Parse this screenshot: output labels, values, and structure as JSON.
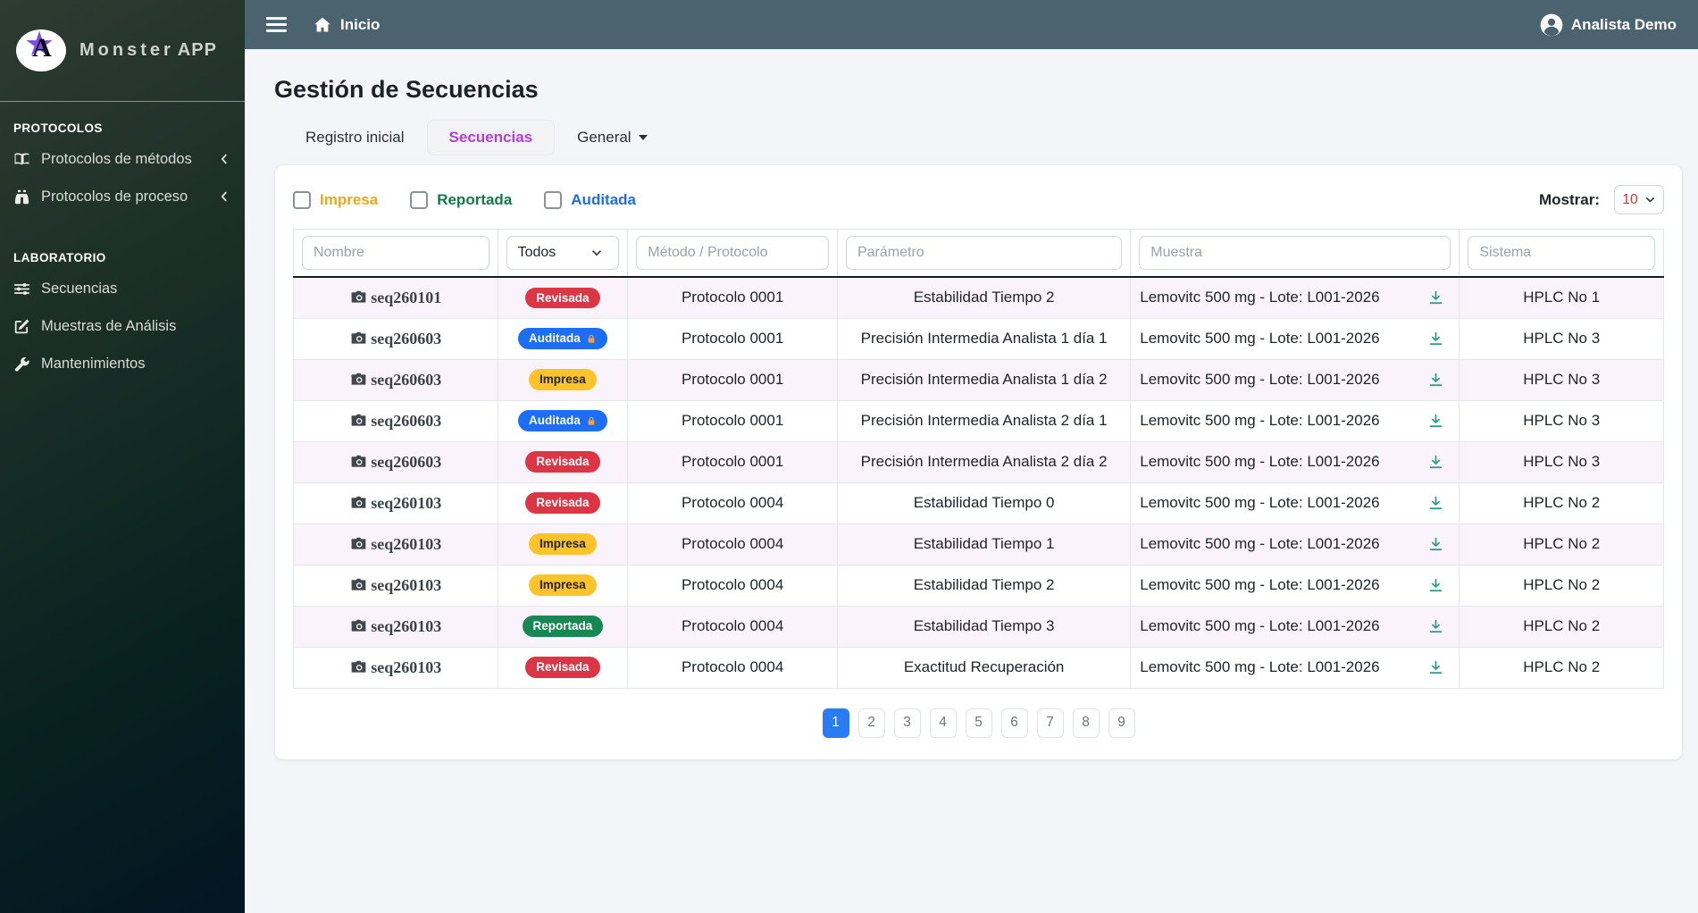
{
  "brand": {
    "name_main": "Monster",
    "name_suffix": "APP"
  },
  "navbar": {
    "breadcrumb": "Inicio",
    "user": "Analista Demo"
  },
  "sidebar": {
    "sections": [
      {
        "title": "PROTOCOLOS",
        "items": [
          {
            "label": "Protocolos de métodos",
            "icon": "book-icon",
            "chevron": true
          },
          {
            "label": "Protocolos de proceso",
            "icon": "binoculars-icon",
            "chevron": true
          }
        ]
      },
      {
        "title": "LABORATORIO",
        "items": [
          {
            "label": "Secuencias",
            "icon": "sliders-icon",
            "chevron": false
          },
          {
            "label": "Muestras de Análisis",
            "icon": "edit-icon",
            "chevron": false
          },
          {
            "label": "Mantenimientos",
            "icon": "wrench-icon",
            "chevron": false
          }
        ]
      }
    ]
  },
  "page": {
    "title": "Gestión de Secuencias",
    "tabs": [
      {
        "label": "Registro inicial",
        "active": false,
        "dropdown": false
      },
      {
        "label": "Secuencias",
        "active": true,
        "dropdown": false
      },
      {
        "label": "General",
        "active": false,
        "dropdown": true
      }
    ]
  },
  "filters": {
    "checkboxes": [
      {
        "label": "Impresa",
        "color": "#f0a818",
        "checked": false
      },
      {
        "label": "Reportada",
        "color": "#157a4b",
        "checked": false
      },
      {
        "label": "Auditada",
        "color": "#1b6ef3",
        "checked": false
      }
    ],
    "show_label": "Mostrar:",
    "show_value": "10"
  },
  "table": {
    "filter_placeholders": {
      "nombre": "Nombre",
      "estado": "Todos",
      "metodo": "Método / Protocolo",
      "parametro": "Parámetro",
      "muestra": "Muestra",
      "sistema": "Sistema"
    },
    "rows": [
      {
        "name": "seq260101",
        "status": {
          "label": "Revisada",
          "variant": "revisada",
          "lock": false
        },
        "protocolo": "Protocolo 0001",
        "parametro": "Estabilidad Tiempo 2",
        "muestra": "Lemovitc 500 mg - Lote: L001-2026",
        "sistema": "HPLC No 1"
      },
      {
        "name": "seq260603",
        "status": {
          "label": "Auditada",
          "variant": "auditada",
          "lock": true
        },
        "protocolo": "Protocolo 0001",
        "parametro": "Precisión Intermedia Analista 1 día 1",
        "muestra": "Lemovitc 500 mg - Lote: L001-2026",
        "sistema": "HPLC No 3"
      },
      {
        "name": "seq260603",
        "status": {
          "label": "Impresa",
          "variant": "impresa",
          "lock": false
        },
        "protocolo": "Protocolo 0001",
        "parametro": "Precisión Intermedia Analista 1 día 2",
        "muestra": "Lemovitc 500 mg - Lote: L001-2026",
        "sistema": "HPLC No 3"
      },
      {
        "name": "seq260603",
        "status": {
          "label": "Auditada",
          "variant": "auditada",
          "lock": true
        },
        "protocolo": "Protocolo 0001",
        "parametro": "Precisión Intermedia Analista 2 día 1",
        "muestra": "Lemovitc 500 mg - Lote: L001-2026",
        "sistema": "HPLC No 3"
      },
      {
        "name": "seq260603",
        "status": {
          "label": "Revisada",
          "variant": "revisada",
          "lock": false
        },
        "protocolo": "Protocolo 0001",
        "parametro": "Precisión Intermedia Analista 2 día 2",
        "muestra": "Lemovitc 500 mg - Lote: L001-2026",
        "sistema": "HPLC No 3"
      },
      {
        "name": "seq260103",
        "status": {
          "label": "Revisada",
          "variant": "revisada",
          "lock": false
        },
        "protocolo": "Protocolo 0004",
        "parametro": "Estabilidad Tiempo 0",
        "muestra": "Lemovitc 500 mg - Lote: L001-2026",
        "sistema": "HPLC No 2"
      },
      {
        "name": "seq260103",
        "status": {
          "label": "Impresa",
          "variant": "impresa",
          "lock": false
        },
        "protocolo": "Protocolo 0004",
        "parametro": "Estabilidad Tiempo 1",
        "muestra": "Lemovitc 500 mg - Lote: L001-2026",
        "sistema": "HPLC No 2"
      },
      {
        "name": "seq260103",
        "status": {
          "label": "Impresa",
          "variant": "impresa",
          "lock": false
        },
        "protocolo": "Protocolo 0004",
        "parametro": "Estabilidad Tiempo 2",
        "muestra": "Lemovitc 500 mg - Lote: L001-2026",
        "sistema": "HPLC No 2"
      },
      {
        "name": "seq260103",
        "status": {
          "label": "Reportada",
          "variant": "reportada",
          "lock": false
        },
        "protocolo": "Protocolo 0004",
        "parametro": "Estabilidad Tiempo 3",
        "muestra": "Lemovitc 500 mg - Lote: L001-2026",
        "sistema": "HPLC No 2"
      },
      {
        "name": "seq260103",
        "status": {
          "label": "Revisada",
          "variant": "revisada",
          "lock": false
        },
        "protocolo": "Protocolo 0004",
        "parametro": "Exactitud Recuperación",
        "muestra": "Lemovitc 500 mg - Lote: L001-2026",
        "sistema": "HPLC No 2"
      }
    ]
  },
  "pagination": {
    "pages": [
      "1",
      "2",
      "3",
      "4",
      "5",
      "6",
      "7",
      "8",
      "9"
    ],
    "active": "1"
  },
  "colors": {
    "badge": {
      "revisada": {
        "bg": "#dc3545",
        "fg": "#ffffff"
      },
      "auditada": {
        "bg": "#1e6ef5",
        "fg": "#ffffff"
      },
      "impresa": {
        "bg": "#fdc32a",
        "fg": "#212529"
      },
      "reportada": {
        "bg": "#198754",
        "fg": "#ffffff"
      }
    },
    "tab_active": "#b43bdc",
    "pagination_active": "#2b7bf3",
    "download_icon": "#2f9e8c",
    "navbar_bg": "#4a636e"
  }
}
